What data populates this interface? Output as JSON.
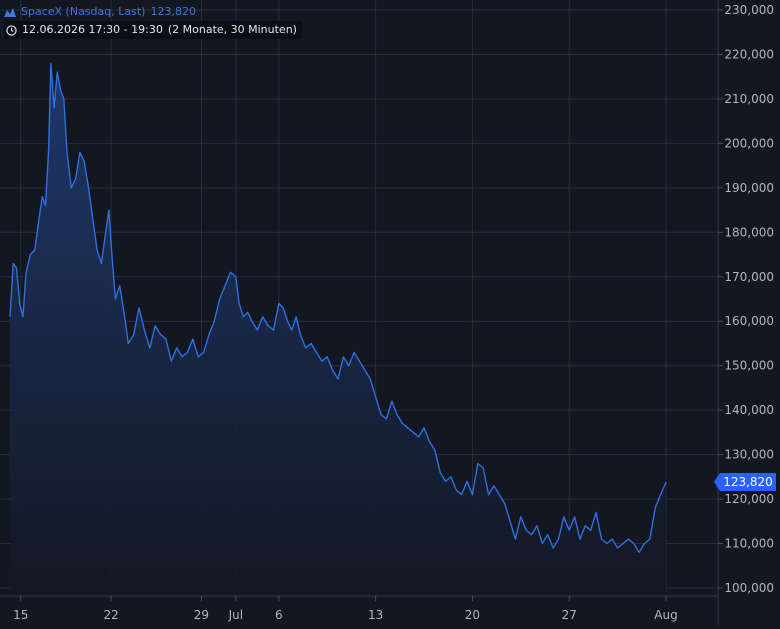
{
  "legend": {
    "instrument": "SpaceX (Nasdaq, Last)",
    "last_value": "123,820",
    "time_range": "12.06.2026 17:30 - 19:30",
    "interval": "(2 Monate, 30 Minuten)",
    "icon_mountain": "mountain-chart-icon",
    "icon_clock": "clock-icon"
  },
  "colors": {
    "background": "#131722",
    "grid": "#2a2e39",
    "line": "#2f6fe0",
    "fill_top": "#1f3460",
    "fill_bottom": "#131722",
    "axis_text": "#b2b5be",
    "price_tag": "#2962ff"
  },
  "price_tag": {
    "value": "123,820",
    "numeric": 123820
  },
  "chart_data": {
    "type": "area",
    "title": "SpaceX (Nasdaq, Last)",
    "ylim": [
      96000,
      231000
    ],
    "yticks": [
      {
        "value": 100000,
        "label": "100,000"
      },
      {
        "value": 110000,
        "label": "110,000"
      },
      {
        "value": 120000,
        "label": "120,000"
      },
      {
        "value": 130000,
        "label": "130,000"
      },
      {
        "value": 140000,
        "label": "140,000"
      },
      {
        "value": 150000,
        "label": "150,000"
      },
      {
        "value": 160000,
        "label": "160,000"
      },
      {
        "value": 170000,
        "label": "170,000"
      },
      {
        "value": 180000,
        "label": "180,000"
      },
      {
        "value": 190000,
        "label": "190,000"
      },
      {
        "value": 200000,
        "label": "200,000"
      },
      {
        "value": 210000,
        "label": "210,000"
      },
      {
        "value": 220000,
        "label": "220,000"
      },
      {
        "value": 230000,
        "label": "230,000"
      }
    ],
    "xlim": [
      0,
      78
    ],
    "xticks": [
      {
        "x": 1.0,
        "label": "15"
      },
      {
        "x": 9.4,
        "label": "22"
      },
      {
        "x": 17.8,
        "label": "29"
      },
      {
        "x": 21.0,
        "label": "Jul"
      },
      {
        "x": 25.0,
        "label": "6"
      },
      {
        "x": 34.0,
        "label": "13"
      },
      {
        "x": 43.0,
        "label": "20"
      },
      {
        "x": 52.0,
        "label": "27"
      },
      {
        "x": 61.0,
        "label": "Aug"
      }
    ],
    "series": [
      {
        "values": [
          [
            0.0,
            161000
          ],
          [
            0.3,
            173000
          ],
          [
            0.6,
            172000
          ],
          [
            0.9,
            164000
          ],
          [
            1.2,
            161000
          ],
          [
            1.5,
            171000
          ],
          [
            1.9,
            175000
          ],
          [
            2.3,
            176000
          ],
          [
            2.7,
            183000
          ],
          [
            3.0,
            188000
          ],
          [
            3.3,
            186000
          ],
          [
            3.6,
            199000
          ],
          [
            3.8,
            218000
          ],
          [
            4.1,
            208000
          ],
          [
            4.4,
            216000
          ],
          [
            4.7,
            212000
          ],
          [
            5.0,
            210000
          ],
          [
            5.3,
            198000
          ],
          [
            5.7,
            190000
          ],
          [
            6.1,
            192000
          ],
          [
            6.5,
            198000
          ],
          [
            6.9,
            196000
          ],
          [
            7.3,
            190000
          ],
          [
            7.7,
            183000
          ],
          [
            8.1,
            176000
          ],
          [
            8.5,
            173000
          ],
          [
            8.9,
            180000
          ],
          [
            9.2,
            185000
          ],
          [
            9.5,
            174000
          ],
          [
            9.8,
            165000
          ],
          [
            10.2,
            168000
          ],
          [
            10.6,
            162000
          ],
          [
            11.0,
            155000
          ],
          [
            11.5,
            157000
          ],
          [
            12.0,
            163000
          ],
          [
            12.5,
            158000
          ],
          [
            13.0,
            154000
          ],
          [
            13.5,
            159000
          ],
          [
            14.0,
            157000
          ],
          [
            14.5,
            156000
          ],
          [
            15.0,
            151000
          ],
          [
            15.5,
            154000
          ],
          [
            16.0,
            152000
          ],
          [
            16.5,
            153000
          ],
          [
            17.0,
            156000
          ],
          [
            17.5,
            152000
          ],
          [
            18.0,
            153000
          ],
          [
            18.5,
            157000
          ],
          [
            19.0,
            160000
          ],
          [
            19.5,
            165000
          ],
          [
            20.0,
            168000
          ],
          [
            20.5,
            171000
          ],
          [
            21.0,
            170000
          ],
          [
            21.3,
            164000
          ],
          [
            21.7,
            161000
          ],
          [
            22.1,
            162000
          ],
          [
            22.5,
            160000
          ],
          [
            23.0,
            158000
          ],
          [
            23.5,
            161000
          ],
          [
            24.0,
            159000
          ],
          [
            24.5,
            158000
          ],
          [
            25.0,
            164000
          ],
          [
            25.4,
            163000
          ],
          [
            25.8,
            160000
          ],
          [
            26.2,
            158000
          ],
          [
            26.6,
            161000
          ],
          [
            27.0,
            157000
          ],
          [
            27.5,
            154000
          ],
          [
            28.0,
            155000
          ],
          [
            28.5,
            153000
          ],
          [
            29.0,
            151000
          ],
          [
            29.5,
            152000
          ],
          [
            30.0,
            149000
          ],
          [
            30.5,
            147000
          ],
          [
            31.0,
            152000
          ],
          [
            31.5,
            150000
          ],
          [
            32.0,
            153000
          ],
          [
            32.5,
            151000
          ],
          [
            33.0,
            149000
          ],
          [
            33.5,
            147000
          ],
          [
            34.0,
            143000
          ],
          [
            34.5,
            139000
          ],
          [
            35.0,
            138000
          ],
          [
            35.5,
            142000
          ],
          [
            36.0,
            139000
          ],
          [
            36.5,
            137000
          ],
          [
            37.0,
            136000
          ],
          [
            37.5,
            135000
          ],
          [
            38.0,
            134000
          ],
          [
            38.5,
            136000
          ],
          [
            39.0,
            133000
          ],
          [
            39.5,
            131000
          ],
          [
            40.0,
            126000
          ],
          [
            40.5,
            124000
          ],
          [
            41.0,
            125000
          ],
          [
            41.5,
            122000
          ],
          [
            42.0,
            121000
          ],
          [
            42.5,
            124000
          ],
          [
            43.0,
            121000
          ],
          [
            43.5,
            128000
          ],
          [
            44.0,
            127000
          ],
          [
            44.5,
            121000
          ],
          [
            45.0,
            123000
          ],
          [
            45.5,
            121000
          ],
          [
            46.0,
            119000
          ],
          [
            46.5,
            115000
          ],
          [
            47.0,
            111000
          ],
          [
            47.5,
            116000
          ],
          [
            48.0,
            113000
          ],
          [
            48.5,
            112000
          ],
          [
            49.0,
            114000
          ],
          [
            49.5,
            110000
          ],
          [
            50.0,
            112000
          ],
          [
            50.5,
            109000
          ],
          [
            51.0,
            111000
          ],
          [
            51.5,
            116000
          ],
          [
            52.0,
            113000
          ],
          [
            52.5,
            116000
          ],
          [
            53.0,
            111000
          ],
          [
            53.5,
            114000
          ],
          [
            54.0,
            113000
          ],
          [
            54.5,
            117000
          ],
          [
            55.0,
            111000
          ],
          [
            55.5,
            110000
          ],
          [
            56.0,
            111000
          ],
          [
            56.5,
            109000
          ],
          [
            57.0,
            110000
          ],
          [
            57.5,
            111000
          ],
          [
            58.0,
            110000
          ],
          [
            58.5,
            108000
          ],
          [
            59.0,
            110000
          ],
          [
            59.5,
            111000
          ],
          [
            60.0,
            118000
          ],
          [
            60.5,
            121000
          ],
          [
            61.0,
            123820
          ]
        ]
      }
    ]
  }
}
